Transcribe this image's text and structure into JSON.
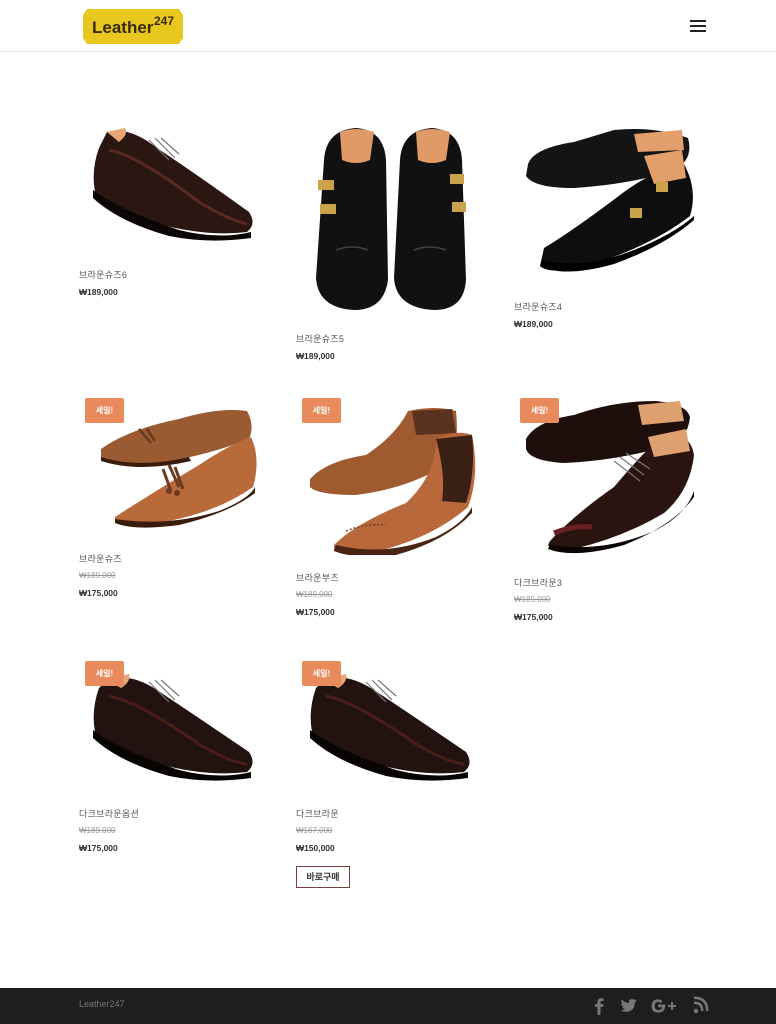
{
  "header": {
    "logo_text": "Leather",
    "logo_number": "247",
    "menu_icon": "hamburger-menu-icon"
  },
  "products": [
    {
      "name": "브라운슈즈6",
      "price": "₩189,000",
      "old_price": null,
      "sale": null,
      "image": "brown-wingtip-oxford"
    },
    {
      "name": "브라운슈즈5",
      "price": "₩189,000",
      "old_price": null,
      "sale": null,
      "image": "black-double-monk-strap-pair"
    },
    {
      "name": "브라운슈즈4",
      "price": "₩189,000",
      "old_price": null,
      "sale": null,
      "image": "black-monk-strap-pair"
    },
    {
      "name": "브라운슈즈",
      "price": "₩175,000",
      "old_price": "₩189,000",
      "sale": "세일!",
      "image": "tan-tassel-loafers"
    },
    {
      "name": "브라운부츠",
      "price": "₩175,000",
      "old_price": "₩189,000",
      "sale": "세일!",
      "image": "tan-chelsea-boots"
    },
    {
      "name": "다크브라운3",
      "price": "₩175,000",
      "old_price": "₩189,000",
      "sale": "세일!",
      "image": "dark-brown-cap-toe-oxfords"
    },
    {
      "name": "다크브라운옵션",
      "price": "₩175,000",
      "old_price": "₩189,000",
      "sale": "세일!",
      "image": "dark-brown-wingtip-oxford"
    },
    {
      "name": "다크브라운",
      "price": "₩150,000",
      "old_price": "₩167,000",
      "sale": "세일!",
      "image": "dark-brown-wingtip-oxford",
      "button": "바로구매"
    }
  ],
  "footer": {
    "brand": "Leather247",
    "social": [
      "facebook-icon",
      "twitter-icon",
      "google-plus-icon",
      "rss-icon"
    ]
  },
  "colors": {
    "sale_badge": "#e88a5c",
    "logo_bg": "#e8c81e",
    "footer_bg": "#1e1e1e",
    "button_border": "#7a3f3f"
  }
}
